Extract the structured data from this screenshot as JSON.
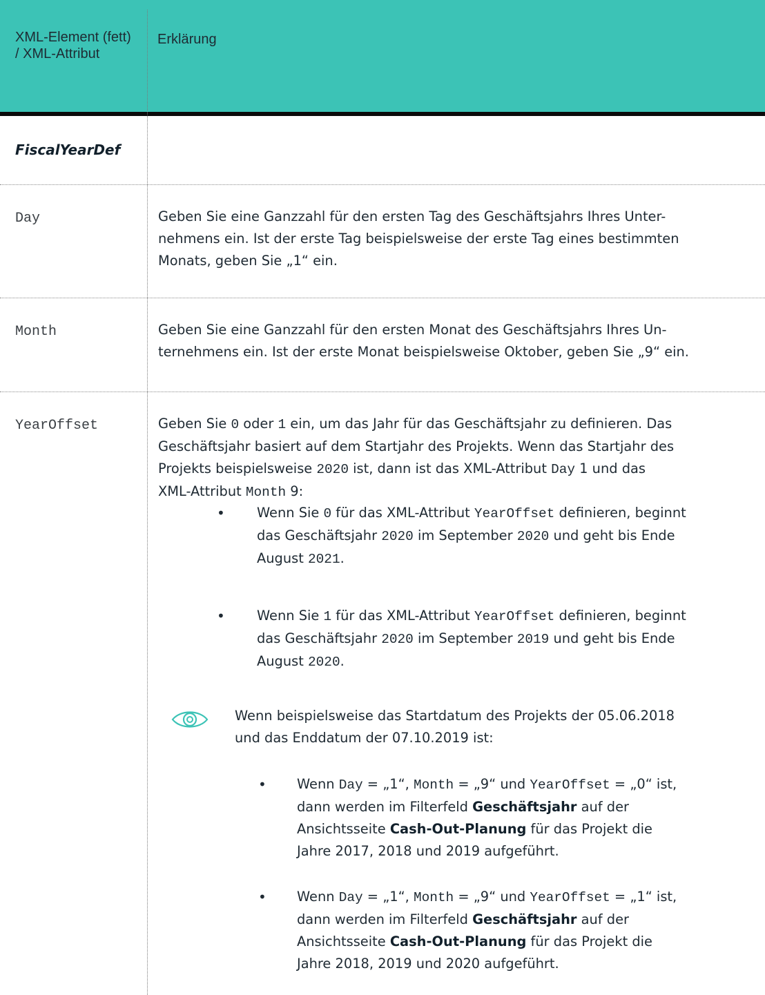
{
  "header": {
    "col1": "XML-Element (fett) / XML-Attribut",
    "col2": "Erklärung"
  },
  "section": "FiscalYearDef",
  "rows": [
    {
      "attribute": "Day",
      "text": "Geben Sie eine Ganzzahl für den ersten Tag des Geschäftsjahrs Ihres Unternehmens ein. Ist der erste Tag beispielsweise der erste Tag eines bestimmten Monats, geben Sie „1“ ein."
    },
    {
      "attribute": "Month",
      "text": "Geben Sie eine Ganzzahl für den ersten Monat des Geschäftsjahrs Ihres Unternehmens ein. Ist der erste Monat beispielsweise Oktober, geben Sie „9“ ein."
    },
    {
      "attribute": "YearOffset",
      "text": "Geben Sie 0 oder 1 ein, um das Jahr für das Geschäftsjahr zu definieren. Das Geschäftsjahr basiert auf dem Startjahr des Projekts. Wenn das Startjahr des Projekts beispielsweise 2020 ist, dann ist das XML-Attribut Day 1 und das XML-Attribut Month 9:",
      "bullets": [
        "Wenn Sie 0 für das XML-Attribut YearOffset definieren, beginnt das Geschäftsjahr 2020 im September 2020 und geht bis Ende August 2021.",
        "Wenn Sie 1 für das XML-Attribut YearOffset definieren, beginnt das Geschäftsjahr 2020 im September 2019 und geht bis Ende August 2020."
      ],
      "note": {
        "icon": "eye-icon",
        "text": "Wenn beispielsweise das Startdatum des Projekts der 05.06.2018 und das Enddatum der 07.10.2019 ist:",
        "bullets": [
          "Wenn Day = „1“, Month = „9“ und YearOffset = „0“ ist, dann werden im Filterfeld Geschäftsjahr auf der Ansichtsseite Cash-Out-Planung für das Projekt die Jahre 2017, 2018 und 2019 aufgeführt.",
          "Wenn Day = „1“, Month = „9“ und YearOffset = „1“ ist, dann werden im Filterfeld Geschäftsjahr auf der Ansichtsseite Cash-Out-Planung für das Projekt die Jahre 2018, 2019 und 2020 aufgeführt."
        ]
      }
    }
  ],
  "colors": {
    "header_bg": "#3cc3b6",
    "icon": "#3cc3b6"
  }
}
